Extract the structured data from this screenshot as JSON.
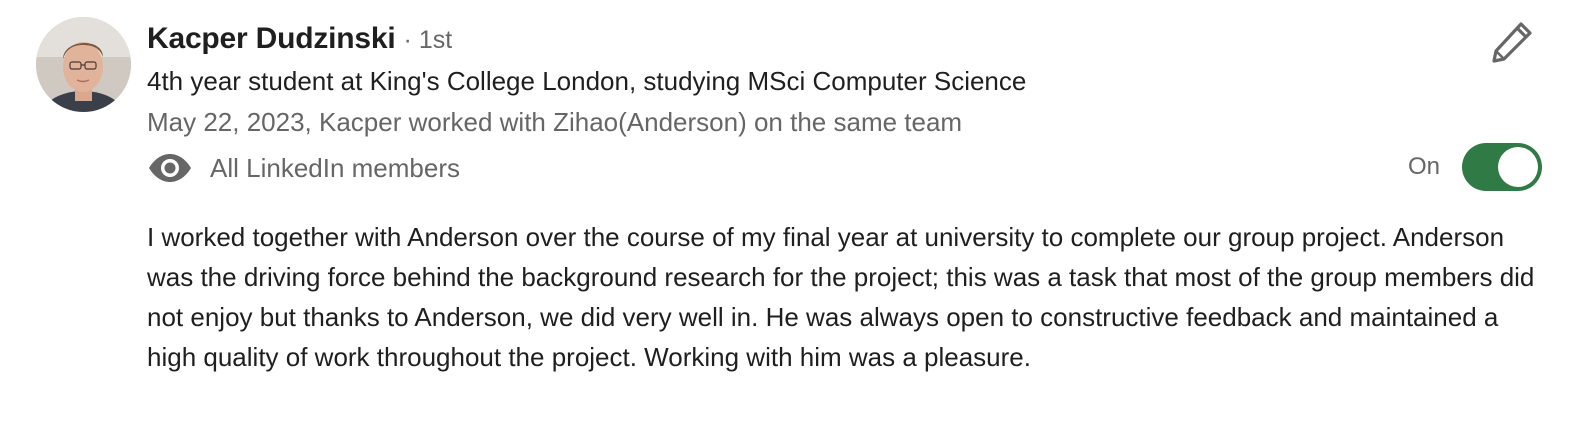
{
  "recommendation": {
    "author": {
      "name": "Kacper Dudzinski",
      "degree": "· 1st",
      "headline": "4th year student at King's College London, studying MSci Computer Science"
    },
    "meta": "May 22, 2023, Kacper worked with Zihao(Anderson) on the same team",
    "visibility": {
      "icon": "eye-icon",
      "label": "All LinkedIn members"
    },
    "toggle": {
      "label": "On",
      "state": "on",
      "color": "#2f7a45"
    },
    "edit_icon": "pencil-icon",
    "text": "I worked together with Anderson over the course of my final year at university to complete our group project. Anderson was the driving force behind the background research for the project; this was a task that most of the group members did not enjoy but thanks to Anderson, we did very well in. He was always open to constructive feedback and maintained a high quality of work throughout the project. Working with him was a pleasure."
  }
}
